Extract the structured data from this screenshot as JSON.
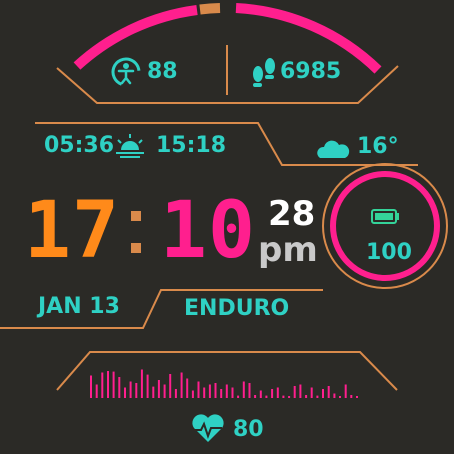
{
  "colors": {
    "background": "#2b2a26",
    "accent_orange": "#d98a4b",
    "hour_orange": "#ff8a1a",
    "minute_pink": "#ff1f8e",
    "teal": "#2fd1c4",
    "white": "#ffffff",
    "gray": "#c9c9c9",
    "battery_green": "#34d399"
  },
  "top_arc": {
    "progress_fraction": 0.58
  },
  "metrics": {
    "body_battery": "88",
    "steps": "6985"
  },
  "sun": {
    "sunrise": "05:36",
    "sunset": "15:18"
  },
  "weather": {
    "temperature": "16°",
    "icon": "partly-cloudy-night-icon"
  },
  "time": {
    "hour": "17",
    "separator": ":",
    "minute": "10",
    "seconds": "28",
    "ampm": "pm"
  },
  "battery": {
    "level": "100",
    "icon": "battery-icon"
  },
  "date": "JAN 13",
  "activity": "ENDURO",
  "heart_rate": {
    "value": "80",
    "icon": "heart-icon",
    "history": [
      0.75,
      0.45,
      0.85,
      0.9,
      0.88,
      0.7,
      0.35,
      0.55,
      0.5,
      0.95,
      0.78,
      0.38,
      0.6,
      0.45,
      0.8,
      0.3,
      0.85,
      0.65,
      0.25,
      0.55,
      0.35,
      0.45,
      0.5,
      0.3,
      0.45,
      0.35,
      0.08,
      0.55,
      0.5,
      0.1,
      0.25,
      0.08,
      0.3,
      0.35,
      0.08,
      0.05,
      0.4,
      0.45,
      0.1,
      0.35,
      0.08,
      0.3,
      0.4,
      0.15,
      0.05,
      0.45,
      0.1,
      0.05
    ]
  }
}
